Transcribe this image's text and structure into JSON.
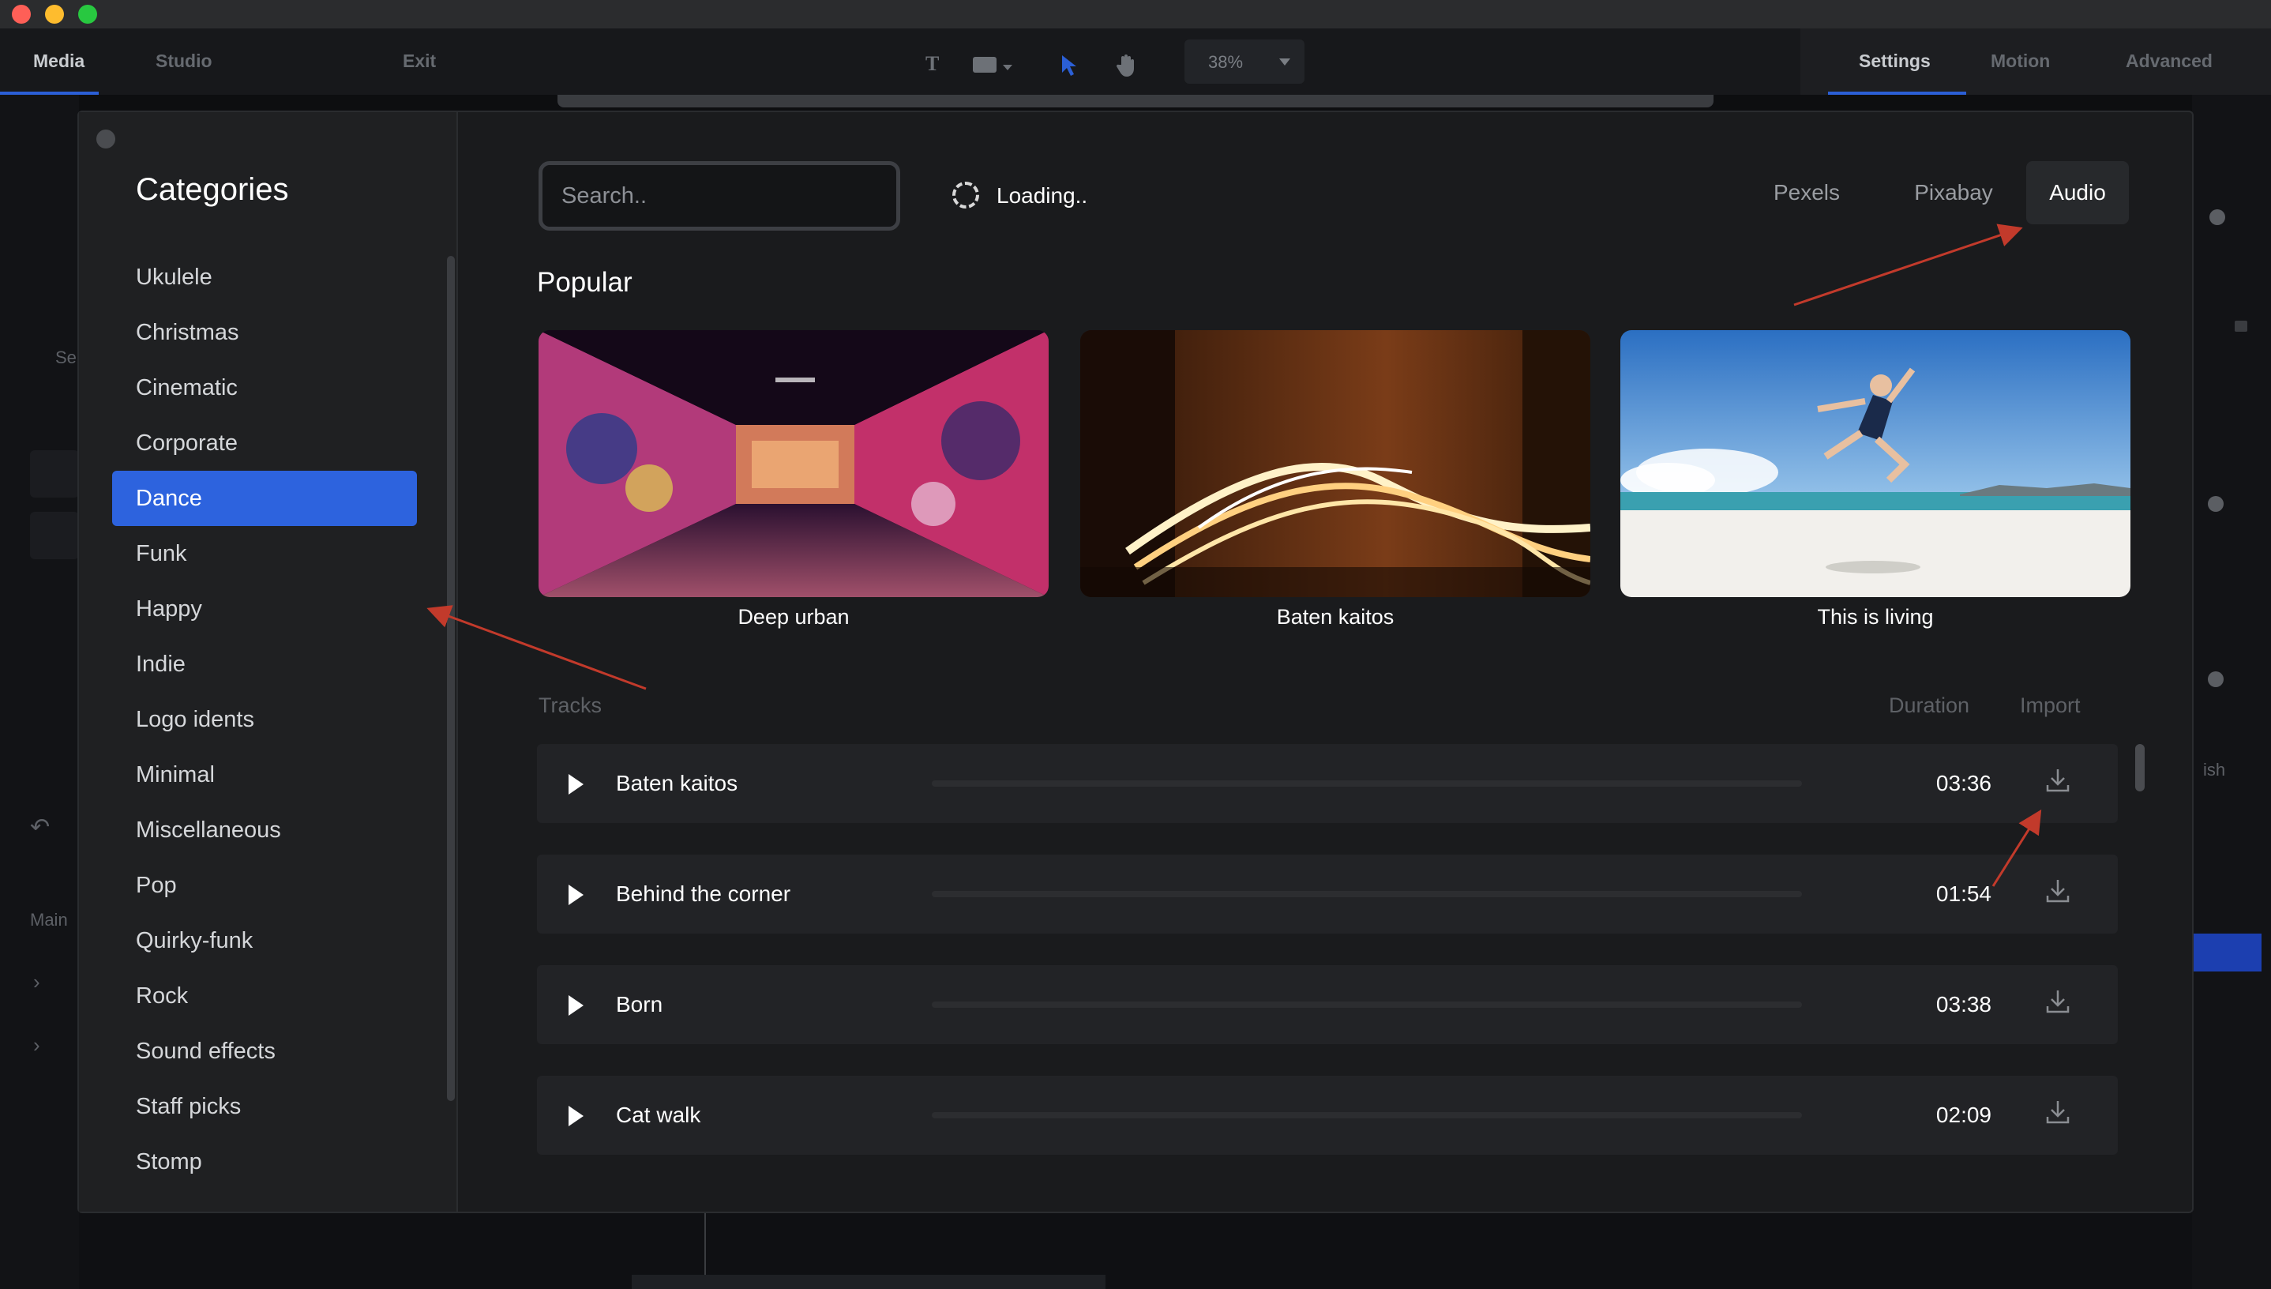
{
  "window": {
    "controls": [
      "close",
      "minimize",
      "zoom"
    ]
  },
  "app": {
    "tabs": [
      {
        "label": "Media",
        "active": true
      },
      {
        "label": "Studio",
        "active": false
      },
      {
        "label": "Exit",
        "active": false
      }
    ],
    "zoom": "38%",
    "right_tabs": [
      {
        "label": "Settings",
        "active": true
      },
      {
        "label": "Motion",
        "active": false
      },
      {
        "label": "Advanced",
        "active": false
      }
    ],
    "left_peek": {
      "se": "Se",
      "main": "Main"
    },
    "right_peek": {
      "ish": "ish"
    }
  },
  "modal": {
    "sidebar": {
      "title": "Categories",
      "items": [
        {
          "label": "Ukulele",
          "active": false
        },
        {
          "label": "Christmas",
          "active": false
        },
        {
          "label": "Cinematic",
          "active": false
        },
        {
          "label": "Corporate",
          "active": false
        },
        {
          "label": "Dance",
          "active": true
        },
        {
          "label": "Funk",
          "active": false
        },
        {
          "label": "Happy",
          "active": false
        },
        {
          "label": "Indie",
          "active": false
        },
        {
          "label": "Logo idents",
          "active": false
        },
        {
          "label": "Minimal",
          "active": false
        },
        {
          "label": "Miscellaneous",
          "active": false
        },
        {
          "label": "Pop",
          "active": false
        },
        {
          "label": "Quirky-funk",
          "active": false
        },
        {
          "label": "Rock",
          "active": false
        },
        {
          "label": "Sound effects",
          "active": false
        },
        {
          "label": "Staff picks",
          "active": false
        },
        {
          "label": "Stomp",
          "active": false
        }
      ]
    },
    "search": {
      "placeholder": "Search..",
      "value": ""
    },
    "loading": "Loading..",
    "source_tabs": [
      {
        "label": "Pexels",
        "active": false
      },
      {
        "label": "Pixabay",
        "active": false
      },
      {
        "label": "Audio",
        "active": true
      }
    ],
    "popular": {
      "title": "Popular",
      "cards": [
        {
          "label": "Deep urban"
        },
        {
          "label": "Baten kaitos"
        },
        {
          "label": "This is living"
        }
      ]
    },
    "tracks": {
      "header": {
        "tracks": "Tracks",
        "duration": "Duration",
        "import": "Import"
      },
      "rows": [
        {
          "name": "Baten kaitos",
          "duration": "03:36"
        },
        {
          "name": "Behind the corner",
          "duration": "01:54"
        },
        {
          "name": "Born",
          "duration": "03:38"
        },
        {
          "name": "Cat walk",
          "duration": "02:09"
        }
      ]
    }
  },
  "colors": {
    "accent": "#2d63de",
    "annotation": "#c23a2b",
    "modal_bg": "#1a1b1d",
    "sidebar_bg": "#1f2022",
    "row_bg": "#222326"
  },
  "icons": [
    "play-icon",
    "download-icon",
    "loading-spinner-icon",
    "text-tool-icon",
    "select-tool-icon",
    "hand-tool-icon",
    "close-dot-icon"
  ]
}
